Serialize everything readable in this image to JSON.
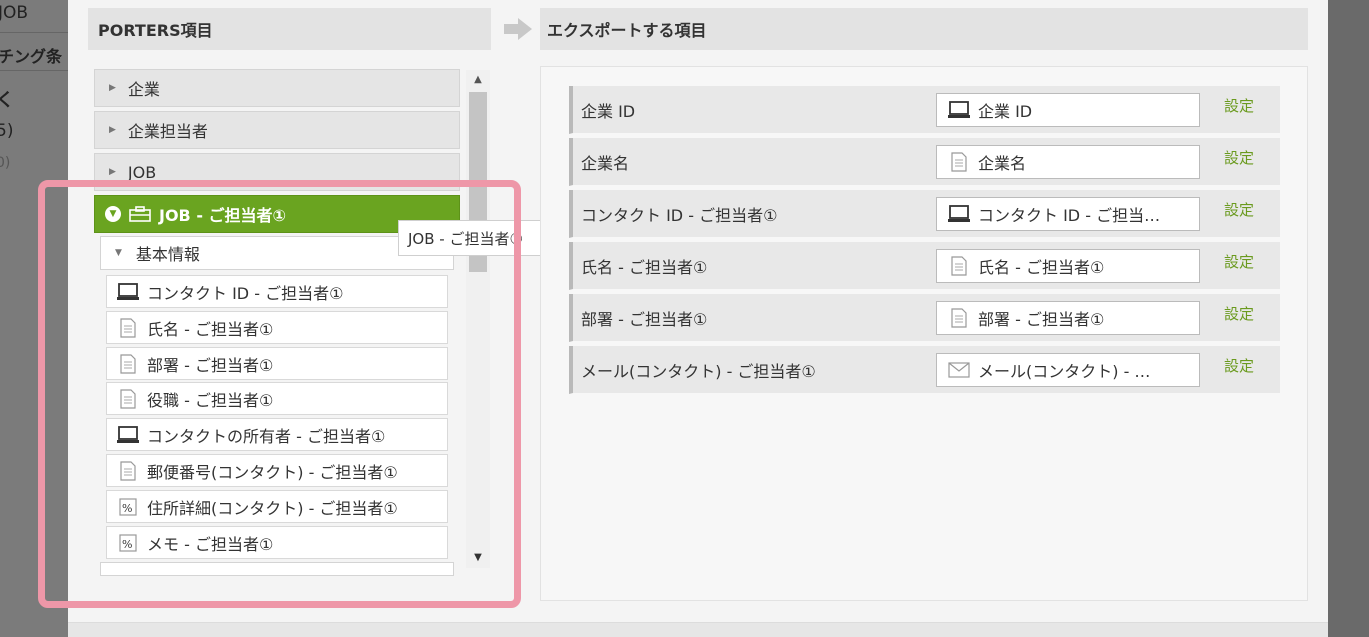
{
  "background": {
    "fragment_1": "JOB",
    "fragment_2": "チング条",
    "fragment_3": "く",
    "fragment_4": "5)",
    "fragment_5": "0)"
  },
  "left_panel": {
    "title": "PORTERS項目",
    "categories": [
      {
        "label": "企業"
      },
      {
        "label": "企業担当者"
      },
      {
        "label": "JOB"
      },
      {
        "label": "JOB - ご担当者①"
      }
    ],
    "subgroup": "基本情報",
    "fields": [
      {
        "label": "コンタクト ID - ご担当者①",
        "icon": "computer-icon"
      },
      {
        "label": "氏名 - ご担当者①",
        "icon": "document-icon"
      },
      {
        "label": "部署 - ご担当者①",
        "icon": "document-icon"
      },
      {
        "label": "役職 - ご担当者①",
        "icon": "document-icon"
      },
      {
        "label": "コンタクトの所有者 - ご担当者①",
        "icon": "computer-icon"
      },
      {
        "label": "郵便番号(コンタクト) - ご担当者①",
        "icon": "document-icon"
      },
      {
        "label": "住所詳細(コンタクト) - ご担当者①",
        "icon": "text-area-icon"
      },
      {
        "label": "メモ - ご担当者①",
        "icon": "text-area-icon"
      }
    ]
  },
  "tooltip": "JOB - ご担当者①",
  "right_panel": {
    "title": "エクスポートする項目",
    "rows": [
      {
        "label": "企業 ID",
        "value": "企業 ID",
        "icon": "computer-icon",
        "action": "設定"
      },
      {
        "label": "企業名",
        "value": "企業名",
        "icon": "document-icon",
        "action": "設定"
      },
      {
        "label": "コンタクト ID - ご担当者①",
        "value": "コンタクト ID - ご担当…",
        "icon": "computer-icon",
        "action": "設定"
      },
      {
        "label": "氏名 - ご担当者①",
        "value": "氏名 - ご担当者①",
        "icon": "document-icon",
        "action": "設定"
      },
      {
        "label": "部署 - ご担当者①",
        "value": "部署 - ご担当者①",
        "icon": "document-icon",
        "action": "設定"
      },
      {
        "label": "メール(コンタクト) - ご担当者①",
        "value": "メール(コンタクト) - …",
        "icon": "mail-icon",
        "action": "設定"
      }
    ]
  },
  "colors": {
    "active_green": "#6aa420",
    "link_green": "#6a9a1e",
    "highlight_pink": "#ee97a8"
  }
}
